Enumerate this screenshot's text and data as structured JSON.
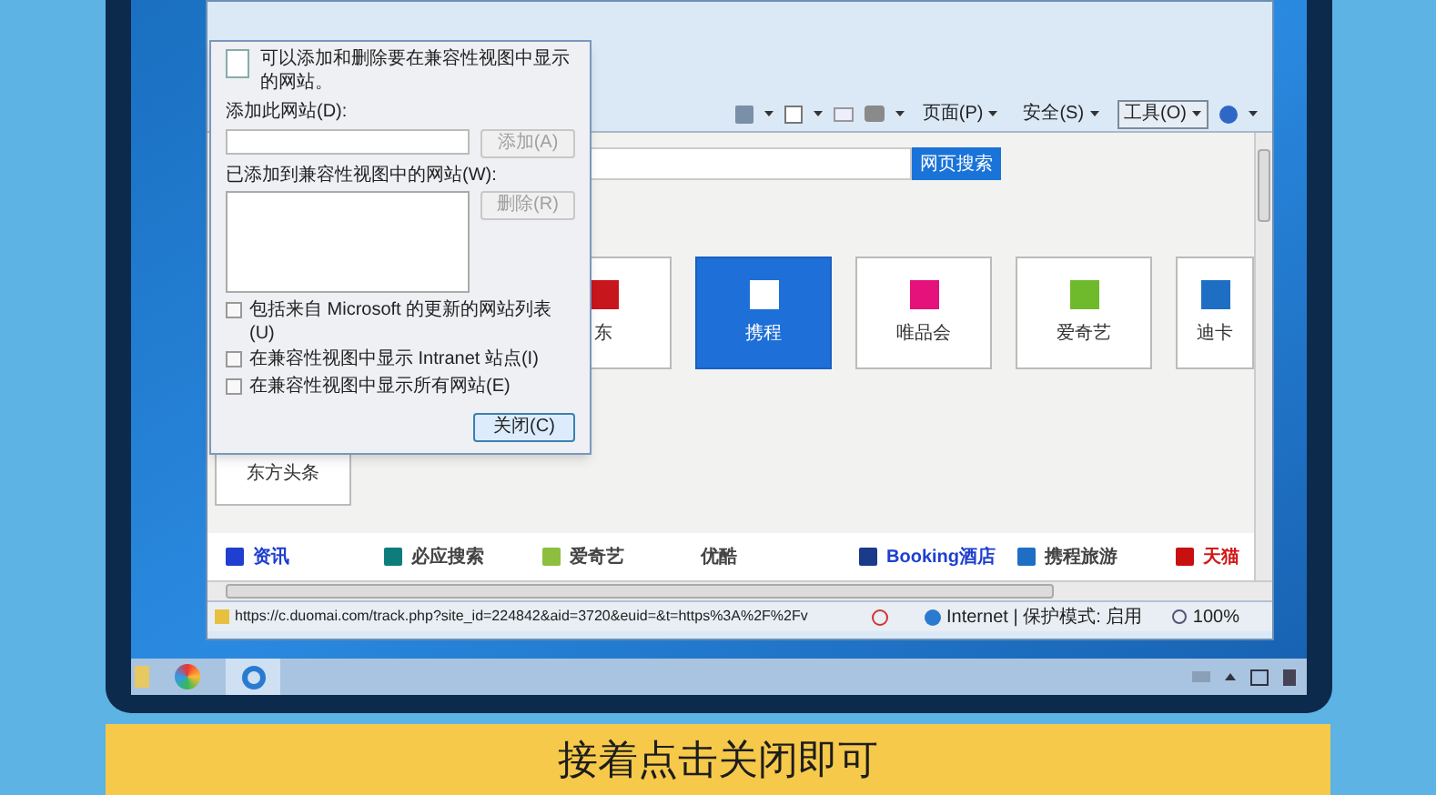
{
  "dialog": {
    "intro": "可以添加和删除要在兼容性视图中显示的网站。",
    "add_label": "添加此网站(D):",
    "add_button": {
      "label": "添加(A)",
      "disabled": true
    },
    "list_label": "已添加到兼容性视图中的网站(W):",
    "remove_button": {
      "label": "删除(R)",
      "disabled": true
    },
    "options": [
      {
        "label": "包括来自 Microsoft 的更新的网站列表(U)",
        "checked": false
      },
      {
        "label": "在兼容性视图中显示 Intranet 站点(I)",
        "checked": false
      },
      {
        "label": "在兼容性视图中显示所有网站(E)",
        "checked": false
      }
    ],
    "close_button": "关闭(C)"
  },
  "toolbar": {
    "menus": [
      {
        "label": "页面(P)",
        "pressed": false
      },
      {
        "label": "安全(S)",
        "pressed": false
      },
      {
        "label": "工具(O)",
        "pressed": true
      }
    ]
  },
  "search": {
    "button": "网页搜索"
  },
  "tiles": [
    {
      "label": "东",
      "selected": false,
      "color": "#c8161d"
    },
    {
      "label": "携程",
      "selected": true,
      "color": "#ffffff"
    },
    {
      "label": "唯品会",
      "selected": false,
      "color": "#e4127a"
    },
    {
      "label": "爱奇艺",
      "selected": false,
      "color": "#6fb92c"
    },
    {
      "label": "迪卡",
      "selected": false,
      "color": "#1e6fc4"
    }
  ],
  "side_tile": "东方头条",
  "links": [
    {
      "label": "资讯",
      "color": "#1e3fd0"
    },
    {
      "label": "必应搜索",
      "color": "#444444"
    },
    {
      "label": "爱奇艺",
      "color": "#444444"
    },
    {
      "label": "优酷",
      "color": "#444444"
    },
    {
      "label": "Booking酒店",
      "color": "#1e3fd0"
    },
    {
      "label": "携程旅游",
      "color": "#444444"
    },
    {
      "label": "天猫",
      "color": "#d01818"
    }
  ],
  "status_bar": {
    "url": "https://c.duomai.com/track.php?site_id=224842&aid=3720&euid=&t=https%3A%2F%2Fv",
    "zone": "Internet | 保护模式: 启用",
    "zoom": "100%"
  },
  "subtitle": "接着点击关闭即可"
}
